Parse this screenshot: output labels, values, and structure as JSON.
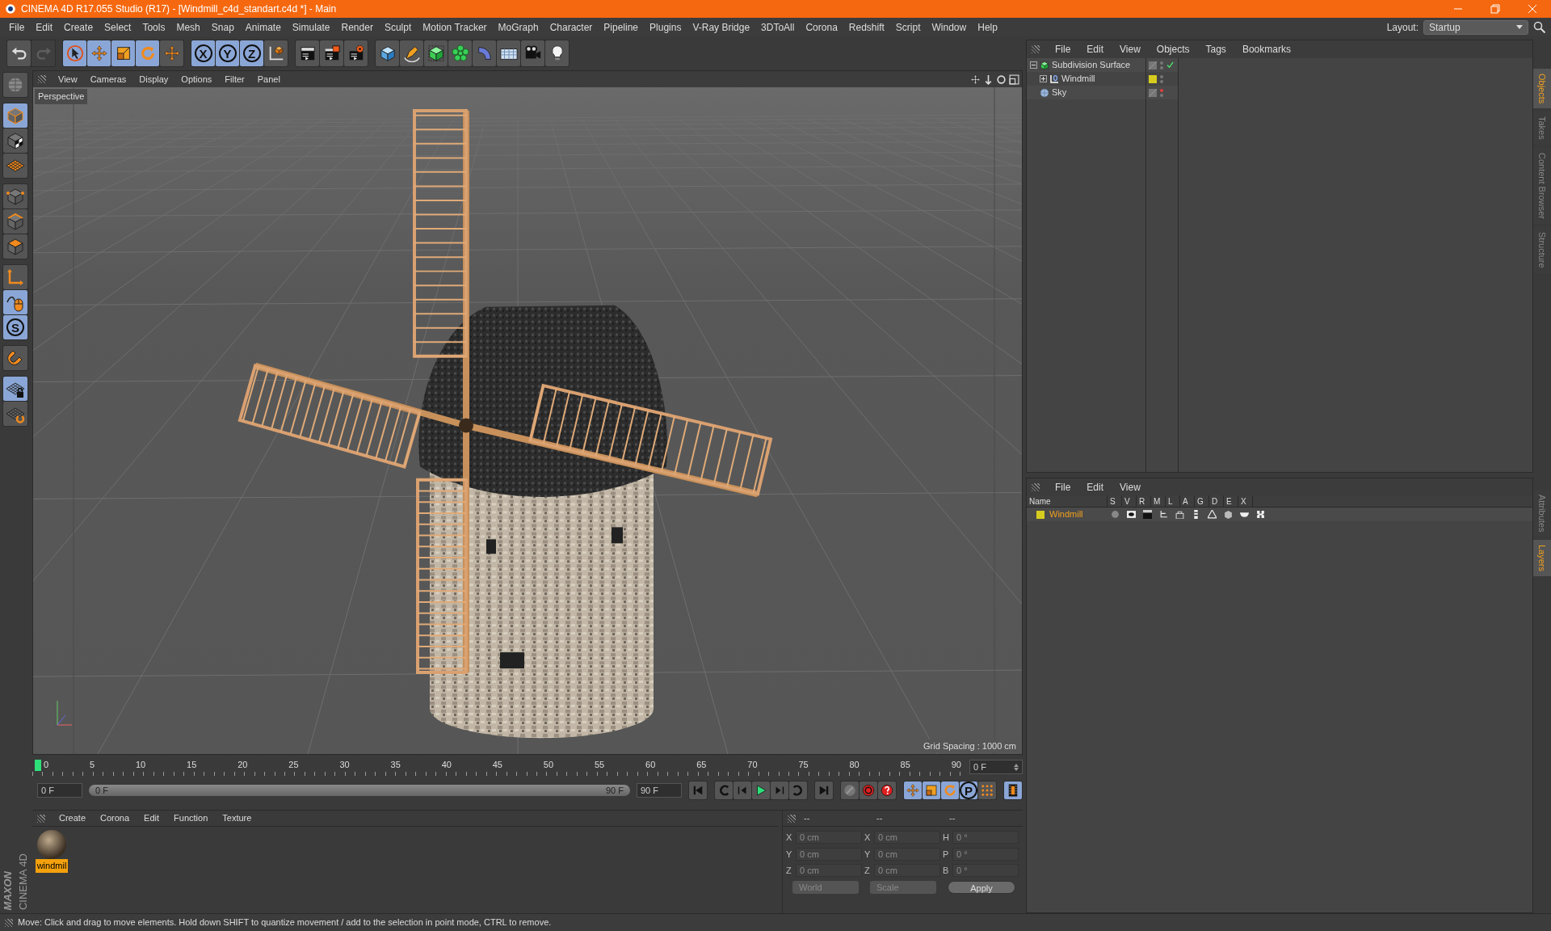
{
  "window": {
    "title": "CINEMA 4D R17.055 Studio (R17) - [Windmill_c4d_standart.c4d *] - Main"
  },
  "menu_bar": [
    "File",
    "Edit",
    "Create",
    "Select",
    "Tools",
    "Mesh",
    "Snap",
    "Animate",
    "Simulate",
    "Render",
    "Sculpt",
    "Motion Tracker",
    "MoGraph",
    "Character",
    "Pipeline",
    "Plugins",
    "V-Ray Bridge",
    "3DToAll",
    "Corona",
    "Redshift",
    "Script",
    "Window",
    "Help"
  ],
  "layout": {
    "label": "Layout:",
    "value": "Startup"
  },
  "toolbar": [
    {
      "kind": "undo",
      "active": false,
      "disabled": false
    },
    {
      "kind": "redo",
      "active": false,
      "disabled": true
    },
    {
      "kind": "select",
      "active": true,
      "disabled": false
    },
    {
      "kind": "move",
      "active": true,
      "disabled": false
    },
    {
      "kind": "scale",
      "active": true,
      "disabled": false
    },
    {
      "kind": "rotate",
      "active": true,
      "disabled": false
    },
    {
      "kind": "move2",
      "active": false,
      "disabled": false
    },
    {
      "kind": "axis",
      "label": "X",
      "active": true,
      "disabled": false
    },
    {
      "kind": "axis",
      "label": "Y",
      "active": true,
      "disabled": false
    },
    {
      "kind": "axis",
      "label": "Z",
      "active": true,
      "disabled": false
    },
    {
      "kind": "coord",
      "active": false,
      "disabled": false
    },
    {
      "kind": "renderview",
      "active": false,
      "disabled": false
    },
    {
      "kind": "render",
      "active": false,
      "disabled": false
    },
    {
      "kind": "rendersettings",
      "active": false,
      "disabled": false
    },
    {
      "kind": "cube",
      "active": false,
      "disabled": false
    },
    {
      "kind": "pen",
      "active": false,
      "disabled": false
    },
    {
      "kind": "subdivision",
      "active": false,
      "disabled": false
    },
    {
      "kind": "cloner",
      "active": false,
      "disabled": false
    },
    {
      "kind": "deformer",
      "active": false,
      "disabled": false
    },
    {
      "kind": "floor",
      "active": false,
      "disabled": false
    },
    {
      "kind": "camera",
      "active": false,
      "disabled": false
    },
    {
      "kind": "light",
      "active": false,
      "disabled": false
    }
  ],
  "left_toolbar": [
    {
      "kind": "editable",
      "active": false
    },
    {
      "kind": "model",
      "active": true
    },
    {
      "kind": "texture",
      "active": false
    },
    {
      "kind": "workplane",
      "active": false
    },
    {
      "kind": "points",
      "active": false
    },
    {
      "kind": "edges",
      "active": false
    },
    {
      "kind": "polygons",
      "active": false
    },
    {
      "kind": "axismode",
      "active": false
    },
    {
      "kind": "tweak",
      "active": true
    },
    {
      "kind": "snap",
      "label": "S",
      "active": true
    },
    {
      "kind": "magnet",
      "active": false
    },
    {
      "kind": "gridlock",
      "active": true
    },
    {
      "kind": "gridrotate",
      "active": false
    }
  ],
  "viewport": {
    "menu": [
      "View",
      "Cameras",
      "Display",
      "Options",
      "Filter",
      "Panel"
    ],
    "camera_label": "Perspective",
    "grid_spacing": "Grid Spacing : 1000 cm"
  },
  "timeline": {
    "ruler_labels": [
      "0",
      "5",
      "10",
      "15",
      "20",
      "25",
      "30",
      "35",
      "40",
      "45",
      "50",
      "55",
      "60",
      "65",
      "70",
      "75",
      "80",
      "85",
      "90"
    ],
    "level": 0,
    "current_field": "0 F"
  },
  "transport": {
    "level": 1,
    "start_field": "0 F",
    "range_start": "0 F",
    "range_end": "90 F",
    "end_field": "90 F",
    "buttons": [
      {
        "kind": "start",
        "active": false
      },
      {
        "kind": "prevkey",
        "active": false
      },
      {
        "kind": "prevframe",
        "active": false
      },
      {
        "kind": "play",
        "active": false
      },
      {
        "kind": "nextframe",
        "active": false
      },
      {
        "kind": "nextkey",
        "active": false
      },
      {
        "kind": "end",
        "active": false
      },
      {
        "kind": "keydisabled",
        "active": false
      },
      {
        "kind": "record",
        "active": false
      },
      {
        "kind": "autokey",
        "active": false
      },
      {
        "kind": "keymove",
        "active": true
      },
      {
        "kind": "keyscale",
        "active": true
      },
      {
        "kind": "keyrotate",
        "active": true
      },
      {
        "kind": "keyparam",
        "label": "P",
        "active": true
      },
      {
        "kind": "keypoints",
        "active": false
      },
      {
        "kind": "film",
        "active": true
      }
    ]
  },
  "material_manager": {
    "menu": [
      "Create",
      "Corona",
      "Edit",
      "Function",
      "Texture"
    ],
    "materials": [
      {
        "name": "windmil",
        "selected": true
      }
    ]
  },
  "coordinates": {
    "headers": [
      "--",
      "--",
      "--"
    ],
    "rows": [
      {
        "fields": [
          {
            "axis": "X",
            "value": "0 cm"
          },
          {
            "axis": "X",
            "value": "0 cm"
          },
          {
            "axis": "H",
            "value": "0 °"
          }
        ]
      },
      {
        "fields": [
          {
            "axis": "Y",
            "value": "0 cm"
          },
          {
            "axis": "Y",
            "value": "0 cm"
          },
          {
            "axis": "P",
            "value": "0 °"
          }
        ]
      },
      {
        "fields": [
          {
            "axis": "Z",
            "value": "0 cm"
          },
          {
            "axis": "Z",
            "value": "0 cm"
          },
          {
            "axis": "B",
            "value": "0 °"
          }
        ]
      }
    ],
    "dropdowns": [
      "World",
      "Scale"
    ],
    "apply": "Apply"
  },
  "object_manager": {
    "menu": [
      "File",
      "Edit",
      "View",
      "Objects",
      "Tags",
      "Bookmarks"
    ],
    "objects": [
      {
        "name": "Subdivision Surface",
        "kind": "subdivision",
        "expanded": true,
        "checked": true,
        "editor_visible": true,
        "children": [
          {
            "name": "Windmill",
            "kind": "null",
            "expanded": false,
            "checked": false,
            "editor_visible": true,
            "color": "#d6cc1e"
          }
        ]
      },
      {
        "name": "Sky",
        "kind": "sky",
        "checked": false,
        "editor_visible": false
      }
    ]
  },
  "layer_manager": {
    "menu": [
      "File",
      "Edit",
      "View"
    ],
    "columns": [
      "Name",
      "S",
      "V",
      "R",
      "M",
      "L",
      "A",
      "G",
      "D",
      "E",
      "X"
    ],
    "layers": [
      {
        "name": "Windmill",
        "color": "#d6cc1e"
      }
    ]
  },
  "side_tabs": [
    {
      "label": "Objects",
      "selected": true
    },
    {
      "label": "Takes",
      "selected": false
    },
    {
      "label": "Content Browser",
      "selected": false
    },
    {
      "label": "Structure",
      "selected": false
    }
  ],
  "side_tabs_lower": [
    {
      "label": "Attributes",
      "selected": false
    },
    {
      "label": "Layers",
      "selected": true
    }
  ],
  "brand": [
    "MAXON",
    "CINEMA 4D"
  ],
  "status_bar": "Move: Click and drag to move elements. Hold down SHIFT to quantize movement / add to the selection in point mode, CTRL to remove."
}
